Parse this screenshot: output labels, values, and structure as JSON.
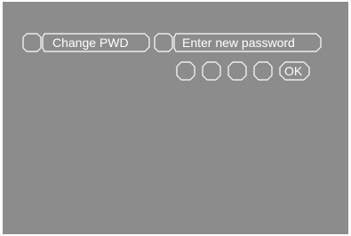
{
  "menu": {
    "change_pwd_label": "Change PWD",
    "password_field_text": "Enter new password"
  },
  "keypad": {
    "digit_slots": [
      "",
      "",
      "",
      ""
    ],
    "ok_label": "OK"
  },
  "colors": {
    "background": "#8c8c8c",
    "foreground": "#ffffff"
  }
}
